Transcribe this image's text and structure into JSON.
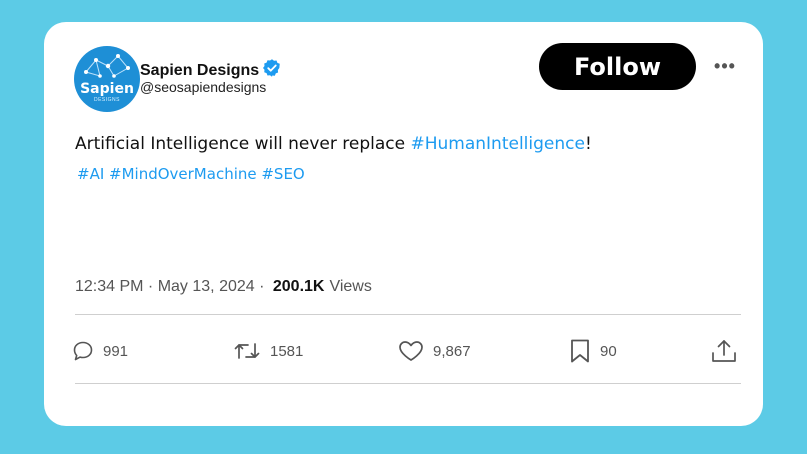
{
  "profile": {
    "name": "Sapien Designs",
    "handle": "@seosapiendesigns",
    "avatar_brand": "Sapien",
    "avatar_subtext": "DESIGNS",
    "verified_icon": "verified-badge-icon"
  },
  "follow_button": {
    "label": "Follow"
  },
  "more_button": {
    "label": "•••"
  },
  "tweet": {
    "text_before": "Artificial Intelligence will never replace ",
    "inline_hashtag": "#HumanIntelligence",
    "text_after": "!",
    "hashtags": "#AI #MindOverMachine #SEO"
  },
  "meta": {
    "time": "12:34 PM",
    "separator1": " · ",
    "date": "May 13, 2024",
    "separator2": " · ",
    "views_count": "200.1K",
    "views_label": "Views"
  },
  "actions": {
    "replies": "991",
    "retweets": "1581",
    "likes": "9,867",
    "bookmarks": "90"
  },
  "colors": {
    "background": "#5ccbe6",
    "card": "#ffffff",
    "hashtag": "#1d9bf0",
    "follow_bg": "#000000",
    "verified": "#1d9bf0"
  }
}
